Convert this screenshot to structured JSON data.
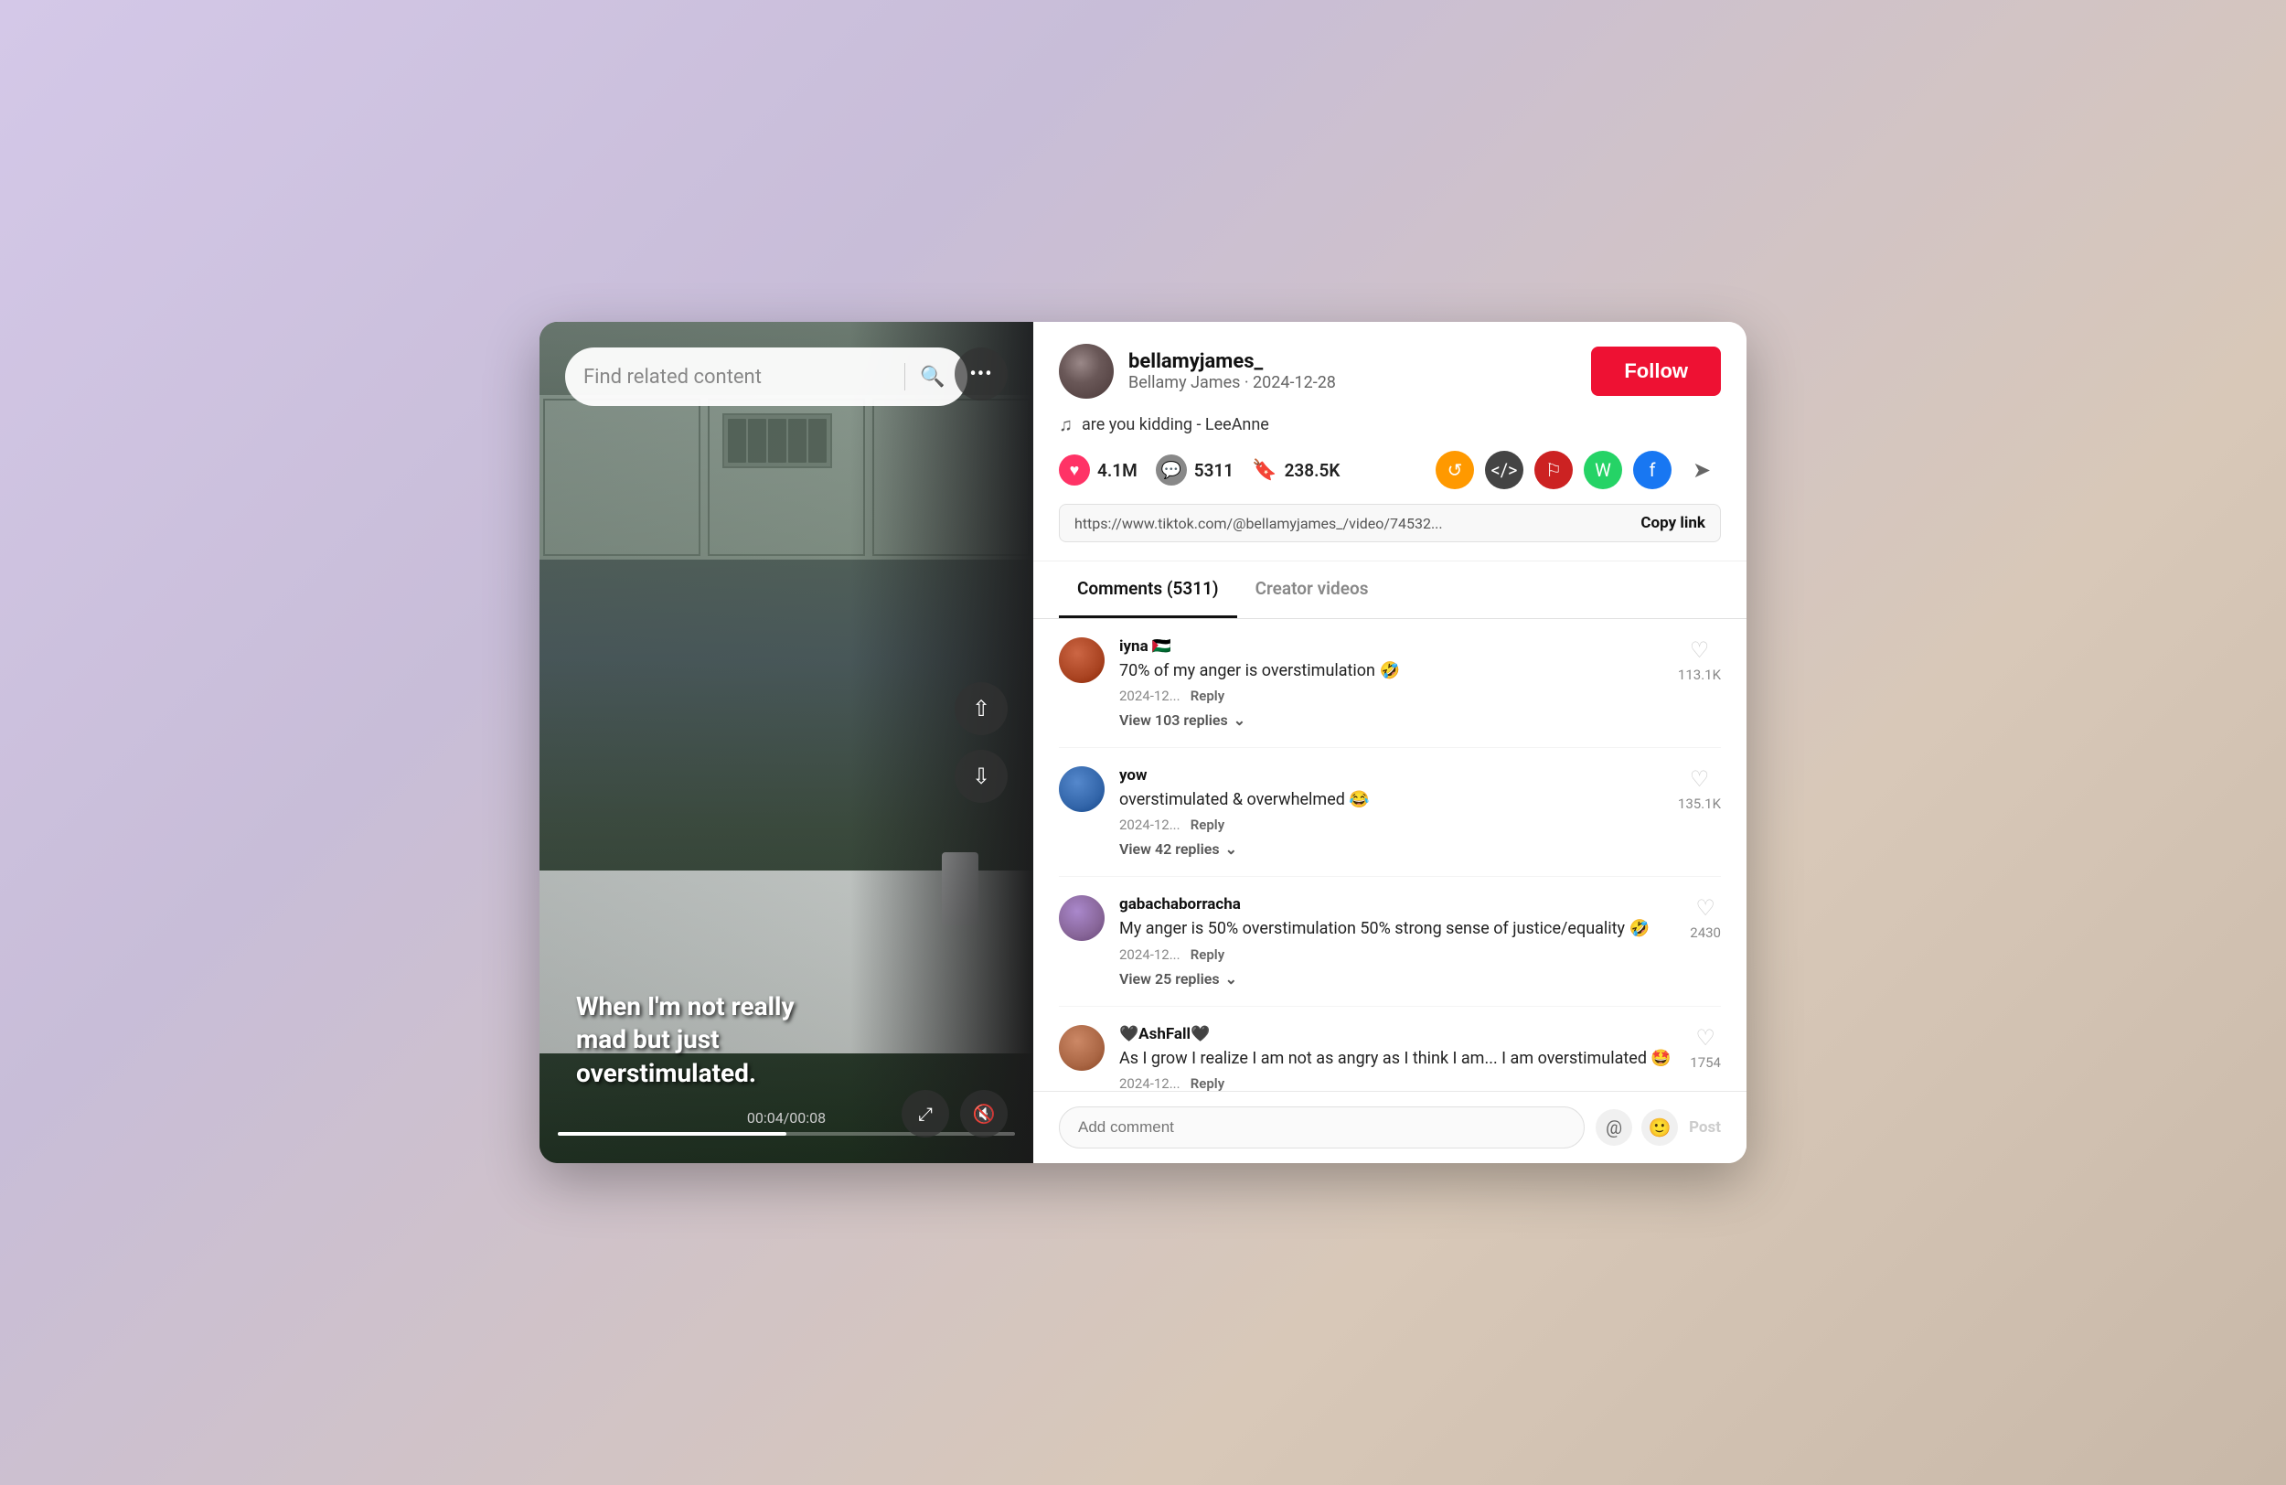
{
  "search": {
    "placeholder": "Find related content"
  },
  "video": {
    "caption": "When I'm not really mad but just overstimulated.",
    "timestamp": "00:04/00:08",
    "progress_percent": 50
  },
  "panel": {
    "username": "bellamyjames_",
    "display_name": "Bellamy James",
    "date": "2024-12-28",
    "user_subinfo": "Bellamy James · 2024-12-28",
    "follow_label": "Follow",
    "music": "are you kidding - LeeAnne",
    "likes": "4.1M",
    "comments": "5311",
    "bookmarks": "238.5K",
    "link": "https://www.tiktok.com/@bellamyjames_/video/74532...",
    "copy_link_label": "Copy link"
  },
  "tabs": [
    {
      "label": "Comments (5311)",
      "active": true
    },
    {
      "label": "Creator videos",
      "active": false
    }
  ],
  "comments": [
    {
      "username": "iyna 🇵🇸",
      "text": "70% of my anger is overstimulation 🤣",
      "date": "2024-12...",
      "likes": "113.1K",
      "replies_label": "View 103 replies"
    },
    {
      "username": "yow",
      "text": "overstimulated & overwhelmed 😂",
      "date": "2024-12...",
      "likes": "135.1K",
      "replies_label": "View 42 replies"
    },
    {
      "username": "gabachaborracha",
      "text": "My anger is 50% overstimulation 50% strong sense of justice/equality 🤣",
      "date": "2024-12...",
      "likes": "2430",
      "replies_label": "View 25 replies"
    },
    {
      "username": "🖤AshFall🖤",
      "text": "As I grow I realize I am not as angry as I think I am... I am overstimulated 🤩",
      "date": "2024-12...",
      "likes": "1754",
      "replies_label": ""
    }
  ],
  "add_comment": {
    "placeholder": "Add comment"
  },
  "post_label": "Post"
}
